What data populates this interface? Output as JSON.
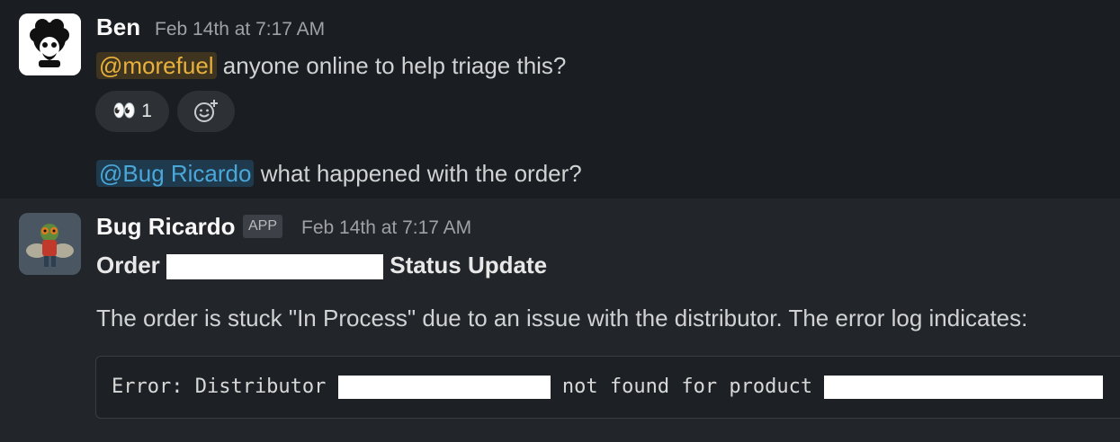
{
  "messages": [
    {
      "author": "Ben",
      "timestamp": "Feb 14th at 7:17 AM",
      "mention": "@morefuel",
      "text": " anyone online to help triage this?",
      "reactions": [
        {
          "emoji": "👀",
          "count": "1"
        }
      ],
      "add_reaction_icon": "add-emoji-icon",
      "followup_mention": "@Bug Ricardo",
      "followup_text": " what happened with the order?"
    },
    {
      "author": "Bug Ricardo",
      "badge": "APP",
      "timestamp": "Feb 14th at 7:17 AM",
      "title_prefix": "Order",
      "title_suffix": "Status Update",
      "body": "The order is stuck \"In Process\" due to an issue with the distributor. The error log indicates:",
      "code_prefix": "Error: Distributor",
      "code_middle": "not found for product"
    }
  ],
  "colors": {
    "background": "#1a1d21",
    "mention_yellow": "#e8b13d",
    "mention_blue": "#4aa7d9"
  }
}
